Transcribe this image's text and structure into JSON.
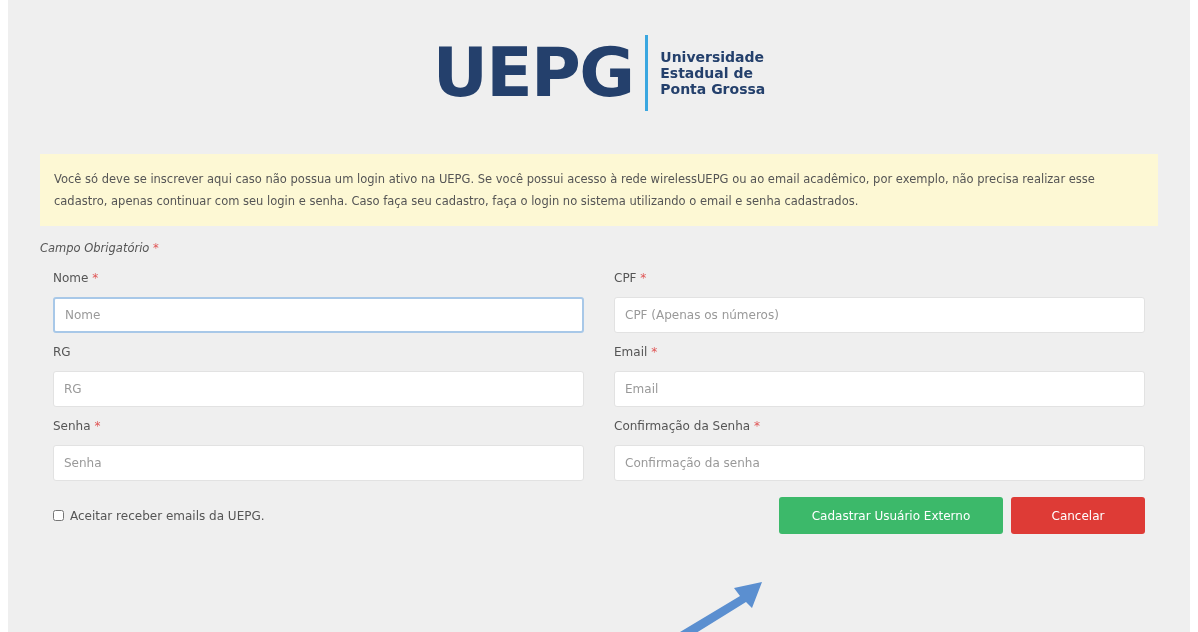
{
  "logo": {
    "mark": "UEPG",
    "name_lines": [
      "Universidade",
      "Estadual de",
      "Ponta Grossa"
    ]
  },
  "notice": "Você só deve se inscrever aqui caso não possua um login ativo na UEPG. Se você possui acesso à rede wirelessUEPG ou ao email acadêmico, por exemplo, não precisa realizar esse cadastro, apenas continuar com seu login e senha. Caso faça seu cadastro, faça o login no sistema utilizando o email e senha cadastrados.",
  "required_note": {
    "text": "Campo Obrigatório",
    "mark": "*"
  },
  "fields": [
    {
      "label": "Nome",
      "required": true,
      "placeholder": "Nome",
      "focused": true
    },
    {
      "label": "CPF",
      "required": true,
      "placeholder": "CPF (Apenas os números)",
      "focused": false
    },
    {
      "label": "RG",
      "required": false,
      "placeholder": "RG",
      "focused": false
    },
    {
      "label": "Email",
      "required": true,
      "placeholder": "Email",
      "focused": false
    },
    {
      "label": "Senha",
      "required": true,
      "placeholder": "Senha",
      "focused": false
    },
    {
      "label": "Confirmação da Senha",
      "required": true,
      "placeholder": "Confirmação da senha",
      "focused": false
    }
  ],
  "required_mark": "*",
  "consent": {
    "label": "Aceitar receber emails da UEPG.",
    "checked": false
  },
  "buttons": [
    {
      "label": "Cadastrar Usuário Externo",
      "kind": "primary"
    },
    {
      "label": "Cancelar",
      "kind": "danger"
    }
  ]
}
